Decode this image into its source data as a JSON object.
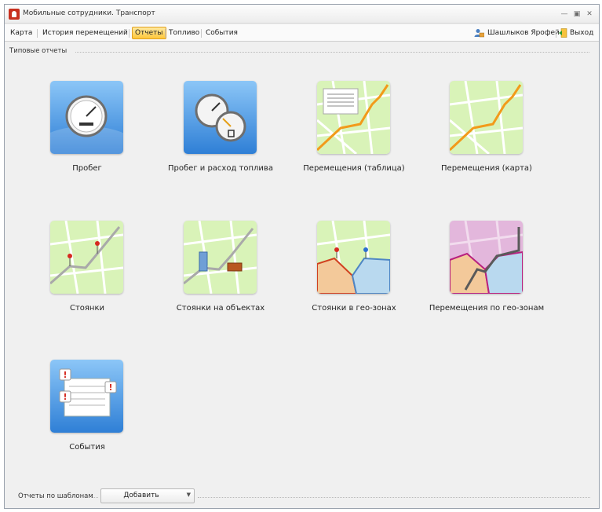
{
  "window": {
    "title": "Мобильные сотрудники. Транспорт"
  },
  "menu": {
    "items": [
      {
        "label": "Карта"
      },
      {
        "label": "История перемещений"
      },
      {
        "label": "Отчеты"
      },
      {
        "label": "Топливо"
      },
      {
        "label": "События"
      }
    ],
    "active_index": 2,
    "user_name": "Шашлыков Ярофей",
    "exit_label": "Выход"
  },
  "reports": {
    "section_title": "Типовые отчеты",
    "tiles": [
      {
        "label": "Пробег",
        "icon": "speedometer-icon"
      },
      {
        "label": "Пробег и расход топлива",
        "icon": "speedometer-fuel-icon"
      },
      {
        "label": "Перемещения (таблица)",
        "icon": "map-table-icon"
      },
      {
        "label": "Перемещения (карта)",
        "icon": "map-route-icon"
      },
      {
        "label": "Стоянки",
        "icon": "map-pins-icon"
      },
      {
        "label": "Стоянки на объектах",
        "icon": "map-buildings-icon"
      },
      {
        "label": "Стоянки в гео-зонах",
        "icon": "map-geozone-pins-icon"
      },
      {
        "label": "Перемещения по гео-зонам",
        "icon": "map-geozone-route-icon"
      },
      {
        "label": "События",
        "icon": "events-icon"
      }
    ]
  },
  "footer": {
    "template_label": "Отчеты по шаблонам",
    "add_button_label": "Добавить"
  },
  "colors": {
    "active_tab": "#ffc73a",
    "tile_blue": "#5aa6ea",
    "map_green": "#d9f3b8",
    "route_orange": "#f29a1a"
  }
}
